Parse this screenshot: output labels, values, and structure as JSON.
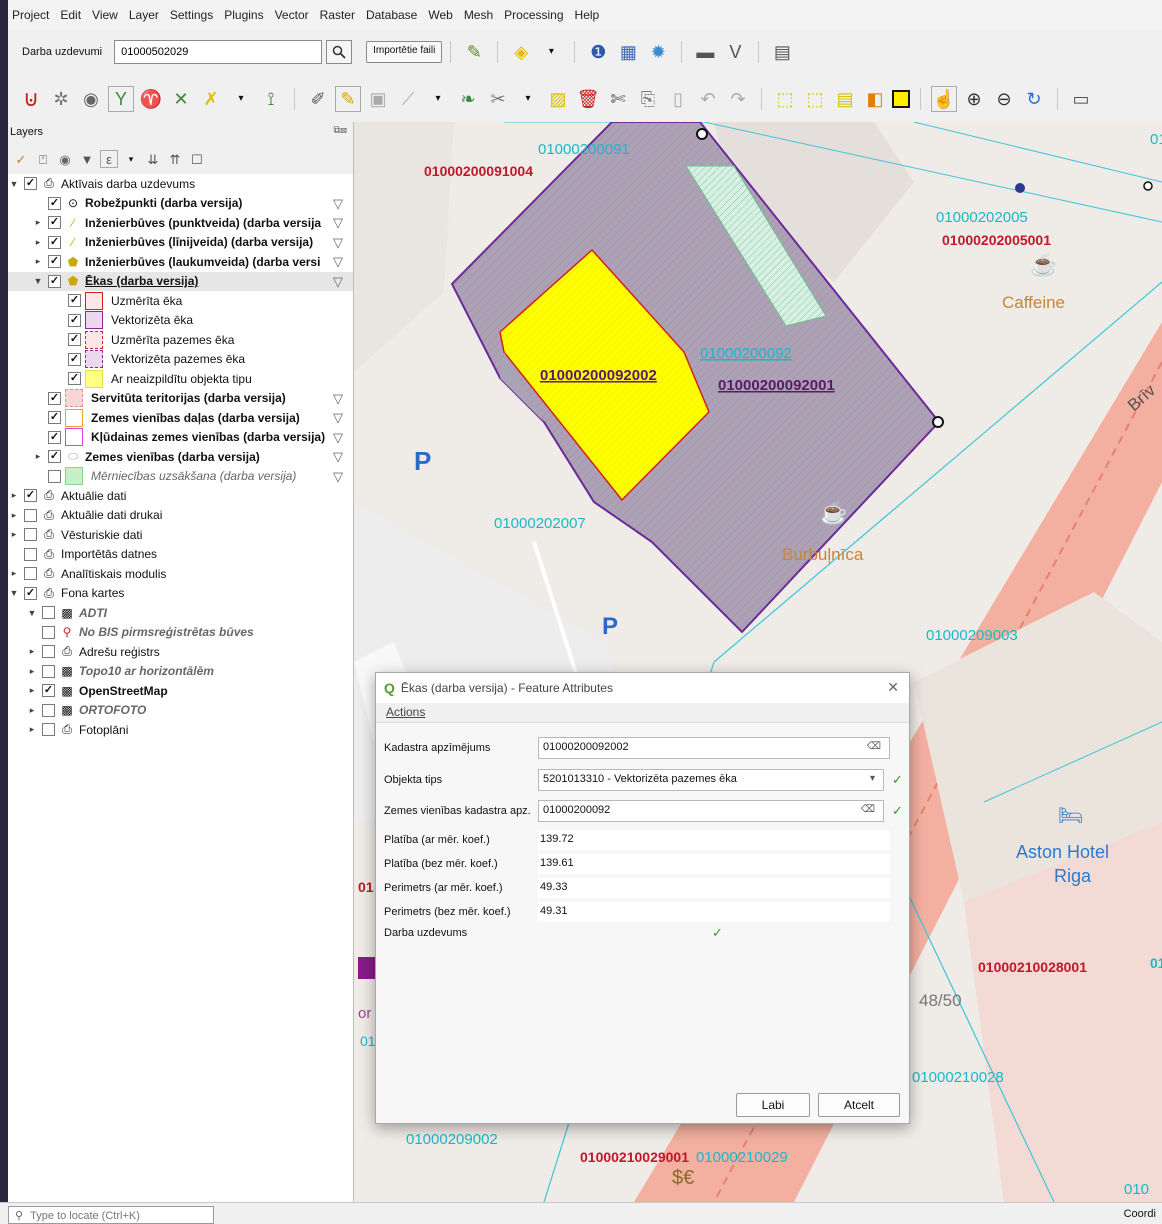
{
  "menu": [
    "Project",
    "Edit",
    "View",
    "Layer",
    "Settings",
    "Plugins",
    "Vector",
    "Raster",
    "Database",
    "Web",
    "Mesh",
    "Processing",
    "Help"
  ],
  "toolbar": {
    "task_label": "Darba uzdevumi",
    "task_value": "01000502029",
    "import_label": "Importētie faili"
  },
  "layers_panel": {
    "title": "Layers",
    "items": [
      {
        "label": "Aktīvais darba uzdevums"
      },
      {
        "label": "Robežpunkti (darba versija)"
      },
      {
        "label": "Inženierbūves (punktveida) (darba versija"
      },
      {
        "label": "Inženierbūves (līnijveida) (darba versija)"
      },
      {
        "label": "Inženierbūves (laukumveida) (darba versi"
      },
      {
        "label": "Ēkas (darba versija)"
      },
      {
        "label": "Uzmērīta ēka"
      },
      {
        "label": "Vektorizēta ēka"
      },
      {
        "label": "Uzmērīta pazemes ēka"
      },
      {
        "label": "Vektorizēta pazemes ēka"
      },
      {
        "label": "Ar neaizpildītu objekta tipu"
      },
      {
        "label": "Servitūta teritorijas (darba versija)"
      },
      {
        "label": "Zemes vienības daļas (darba versija)"
      },
      {
        "label": "Kļūdainas zemes vienības (darba versija)"
      },
      {
        "label": "Zemes vienības (darba versija)"
      },
      {
        "label": "Mērniecības uzsākšana (darba versija)"
      },
      {
        "label": "Aktuālie dati"
      },
      {
        "label": "Aktuālie dati drukai"
      },
      {
        "label": "Vēsturiskie dati"
      },
      {
        "label": "Importētās datnes"
      },
      {
        "label": "Analītiskais modulis"
      },
      {
        "label": "Fona kartes"
      },
      {
        "label": "ADTI"
      },
      {
        "label": "No BIS pirmsreģistrētas būves"
      },
      {
        "label": "Adrešu reģistrs"
      },
      {
        "label": "Topo10 ar horizontālēm"
      },
      {
        "label": "OpenStreetMap"
      },
      {
        "label": "ORTOFOTO"
      },
      {
        "label": "Fotoplāni"
      }
    ]
  },
  "map_labels": {
    "l1": "01000200091",
    "l2": "01000200091004",
    "l3": "01000202005",
    "l4": "01000202005001",
    "l5": "Caffeine",
    "l6": "01000200092",
    "l7": "01000200092002",
    "l8": "01000200092001",
    "l9": "Brīv",
    "l10": "01000202007",
    "l11": "Burbuļnīca",
    "l12": "01000209003",
    "l13": "Aston Hotel",
    "l14": "Riga",
    "l15": "01000210028001",
    "l16": "48/50",
    "l17": "01000210028",
    "l18": "01000209002",
    "l19": "01000210029001",
    "l20": "01000210029",
    "l21": "010",
    "l22": "01",
    "l23": "P",
    "l24": "01",
    "l25": "01",
    "l26": "or",
    "l27": "01"
  },
  "dialog": {
    "title": "Ēkas (darba versija) - Feature Attributes",
    "menu": "Actions",
    "fields": [
      {
        "label": "Kadastra apzīmējums",
        "value": "01000200092002"
      },
      {
        "label": "Objekta tips",
        "value": "5201013310 - Vektorizēta pazemes ēka"
      },
      {
        "label": "Zemes vienības kadastra apz.",
        "value": "01000200092"
      },
      {
        "label": "Platība (ar mēr. koef.)",
        "value": "139.72"
      },
      {
        "label": "Platība (bez mēr. koef.)",
        "value": "139.61"
      },
      {
        "label": "Perimetrs (ar mēr. koef.)",
        "value": "49.33"
      },
      {
        "label": "Perimetrs (bez mēr. koef.)",
        "value": "49.31"
      },
      {
        "label": "Darba uzdevums",
        "value": ""
      }
    ],
    "ok_label": "Labi",
    "cancel_label": "Atcelt"
  },
  "status": {
    "locate_placeholder": "Type to locate (Ctrl+K)",
    "coord_label": "Coordi"
  },
  "colors": {
    "parcel_fill": "#a9a3b8",
    "parcel_stroke": "#6a2a9a",
    "selected_building": "#ffff00",
    "label_red": "#c0182a",
    "label_cyan": "#19b8c8",
    "road": "#f3b0a0"
  }
}
